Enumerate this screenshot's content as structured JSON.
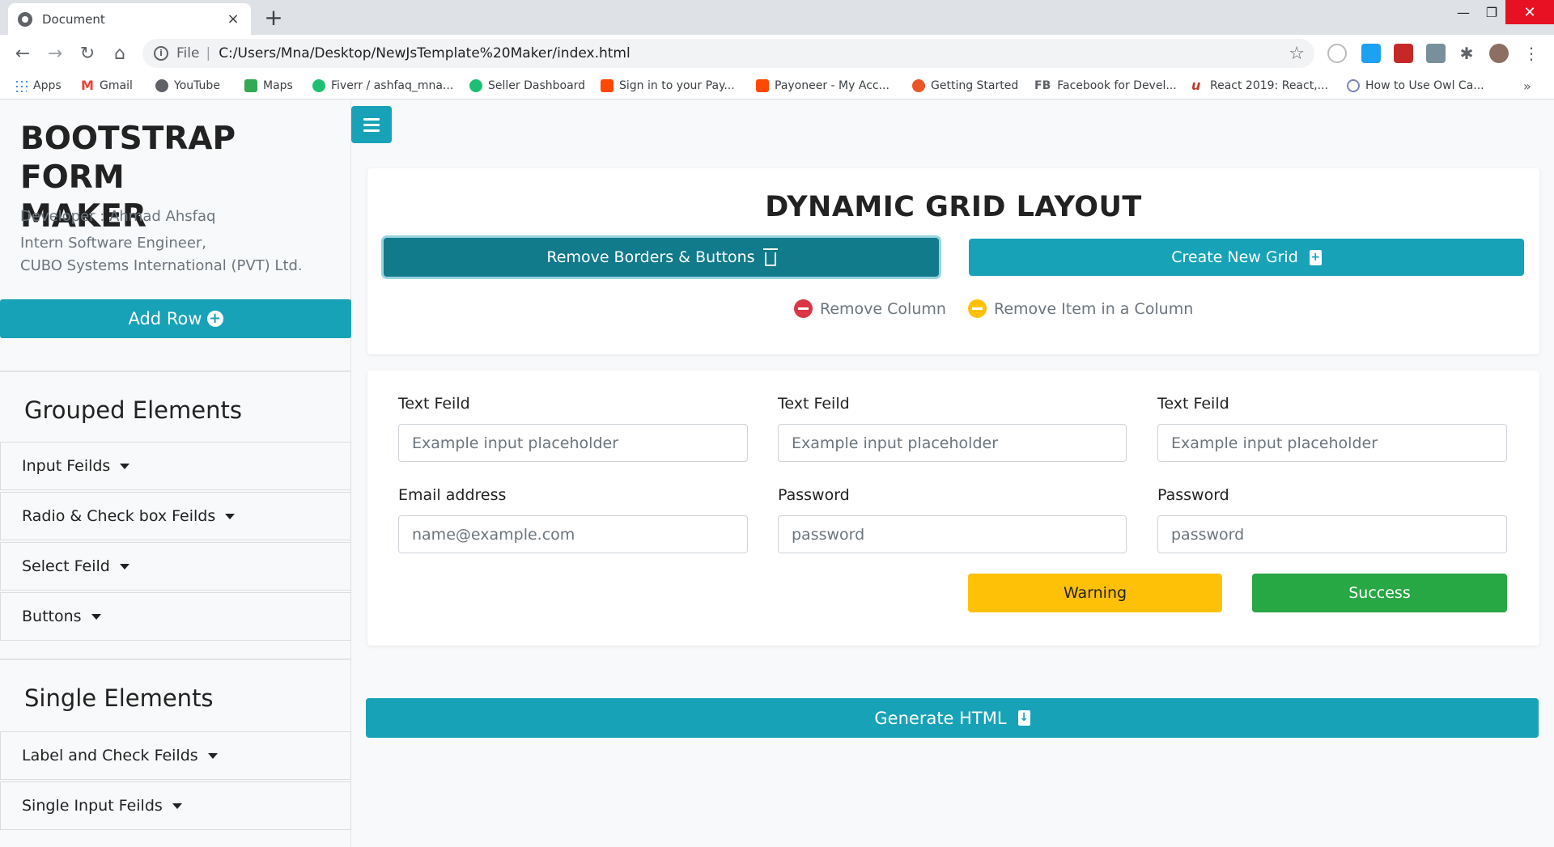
{
  "browser": {
    "tab_title": "Document",
    "tab_close": "×",
    "new_tab": "+",
    "window_controls": {
      "minimize": "—",
      "maximize": "❐",
      "close": "✕"
    },
    "nav": {
      "back": "←",
      "forward": "→",
      "reload": "↻",
      "home": "⌂"
    },
    "address": {
      "scheme": "File",
      "separator": "|",
      "url": "C:/Users/Mna/Desktop/NewJsTemplate%20Maker/index.html"
    },
    "bookmarks": [
      {
        "label": "Apps",
        "color": "#4285f4"
      },
      {
        "label": "Gmail",
        "color": "#ea4335"
      },
      {
        "label": "YouTube",
        "color": "#5f6368"
      },
      {
        "label": "Maps",
        "color": "#34a853"
      },
      {
        "label": "Fiverr / ashfaq_mna...",
        "color": "#1dbf73"
      },
      {
        "label": "Seller Dashboard",
        "color": "#1dbf73"
      },
      {
        "label": "Sign in to your Pay...",
        "color": "#ff4800"
      },
      {
        "label": "Payoneer - My Acc...",
        "color": "#ff4800"
      },
      {
        "label": "Getting Started",
        "color": "#eb5424"
      },
      {
        "label": "Facebook for Devel...",
        "color": "#5f6368"
      },
      {
        "label": "React 2019: React,...",
        "color": "#c0392b"
      },
      {
        "label": "How to Use Owl Ca...",
        "color": "#7c83b8"
      }
    ],
    "bookmarks_more": "»",
    "fb_prefix": "FB"
  },
  "sidebar": {
    "brand_line1": "BOOTSTRAP FORM",
    "brand_line2": "MAKER",
    "developer": "Developer : Ahmad Ahsfaq",
    "role": "Intern Software Engineer,",
    "company": "CUBO Systems International (PVT) Ltd.",
    "add_row": "Add Row",
    "grouped_title": "Grouped Elements",
    "grouped_items": [
      "Input Feilds",
      "Radio & Check box Feilds",
      "Select Feild",
      "Buttons"
    ],
    "single_title": "Single Elements",
    "single_items": [
      "Label and Check Feilds",
      "Single Input Feilds"
    ]
  },
  "grid_card": {
    "title": "DYNAMIC GRID LAYOUT",
    "remove_btn": "Remove Borders & Buttons",
    "create_btn": "Create New Grid",
    "legend_remove_column": "Remove Column",
    "legend_remove_item": "Remove Item in a Column"
  },
  "form": {
    "fields": [
      {
        "label": "Text Feild",
        "placeholder": "Example input placeholder"
      },
      {
        "label": "Text Feild",
        "placeholder": "Example input placeholder"
      },
      {
        "label": "Text Feild",
        "placeholder": "Example input placeholder"
      },
      {
        "label": "Email address",
        "placeholder": "name@example.com"
      },
      {
        "label": "Password",
        "placeholder": "password"
      },
      {
        "label": "Password",
        "placeholder": "password"
      }
    ],
    "warning_btn": "Warning",
    "success_btn": "Success"
  },
  "generate_btn": "Generate HTML",
  "colors": {
    "info": "#17a2b8",
    "info_dark": "#117a8b",
    "danger": "#dc3545",
    "warning": "#ffc107",
    "success": "#28a745"
  }
}
